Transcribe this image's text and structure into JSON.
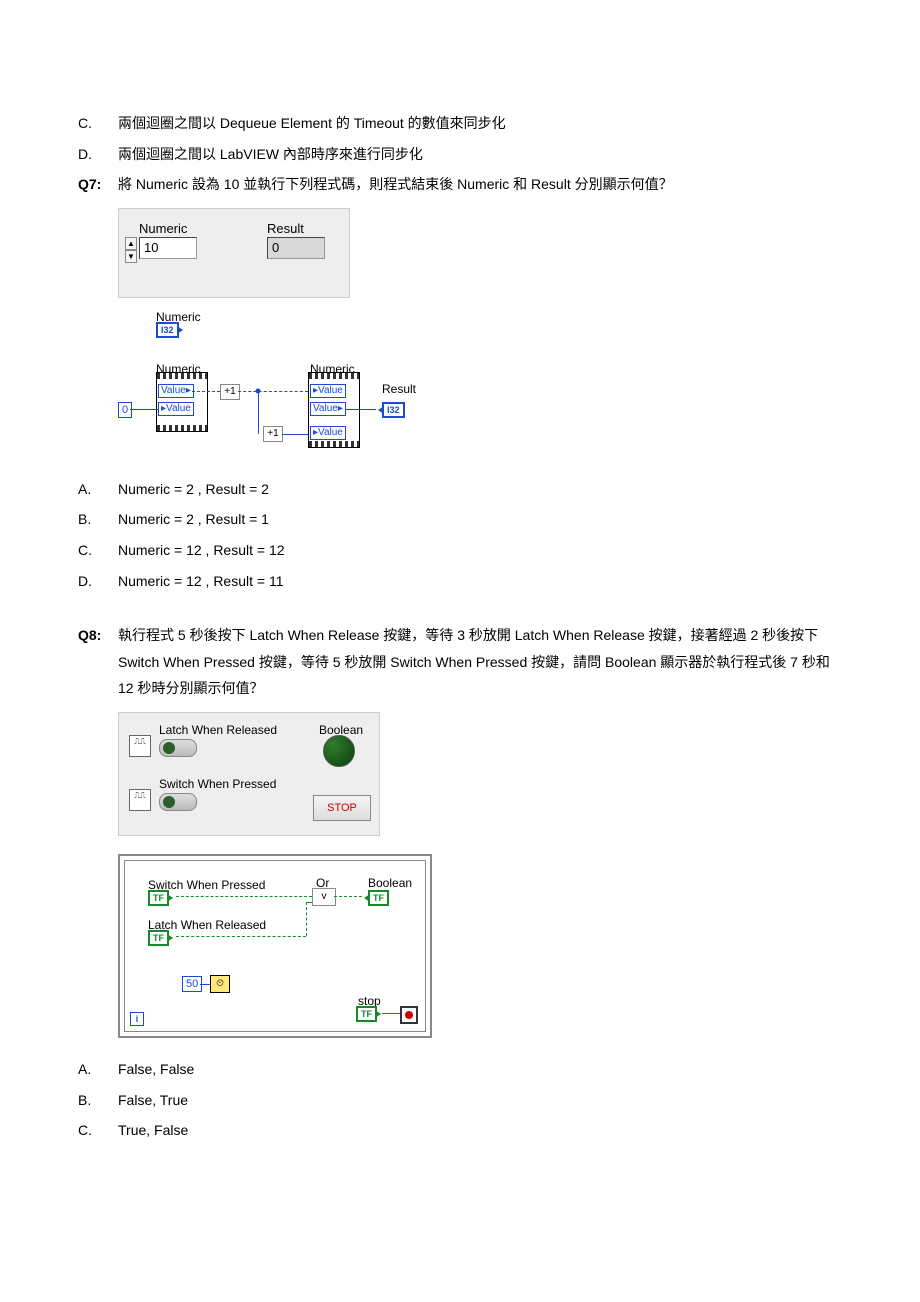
{
  "pre": {
    "c": {
      "label": "C.",
      "text": "兩個迴圈之間以 Dequeue Element 的 Timeout 的數值來同步化"
    },
    "d": {
      "label": "D.",
      "text": "兩個迴圈之間以 LabVIEW 內部時序來進行同步化"
    }
  },
  "q7": {
    "label": "Q7:",
    "text": "將 Numeric 設為 10 並執行下列程式碼，則程式結束後 Numeric 和 Result 分別顯示何值？",
    "fp": {
      "numeric_label": "Numeric",
      "numeric_value": "10",
      "result_label": "Result",
      "result_value": "0"
    },
    "bd": {
      "numeric_term": "Numeric",
      "i32": "I32",
      "value": "Value",
      "zero": "0",
      "inc": "+1",
      "result_term": "Result"
    },
    "answers": {
      "a": {
        "label": "A.",
        "text": "Numeric = 2 , Result = 2"
      },
      "b": {
        "label": "B.",
        "text": "Numeric = 2 , Result = 1"
      },
      "c": {
        "label": "C.",
        "text": "Numeric = 12 , Result = 12"
      },
      "d": {
        "label": "D.",
        "text": "Numeric = 12 , Result = 11"
      }
    }
  },
  "q8": {
    "label": "Q8:",
    "text": "執行程式 5 秒後按下 Latch When Release 按鍵，等待 3 秒放開 Latch When Release 按鍵，接著經過 2 秒後按下 Switch When Pressed 按鍵，等待 5 秒放開 Switch When Pressed 按鍵，請問 Boolean 顯示器於執行程式後 7 秒和 12 秒時分別顯示何值？",
    "fp": {
      "latch_label": "Latch When Released",
      "switch_label": "Switch When Pressed",
      "boolean_label": "Boolean",
      "stop_label": "STOP"
    },
    "bd": {
      "switch_label": "Switch When Pressed",
      "latch_label": "Latch When Released",
      "or_label": "Or",
      "boolean_label": "Boolean",
      "stop_label": "stop",
      "tf": "TF",
      "fifty": "50",
      "i": "i"
    },
    "answers": {
      "a": {
        "label": "A.",
        "text": "False, False"
      },
      "b": {
        "label": "B.",
        "text": "False, True"
      },
      "c": {
        "label": "C.",
        "text": "True, False"
      }
    }
  }
}
